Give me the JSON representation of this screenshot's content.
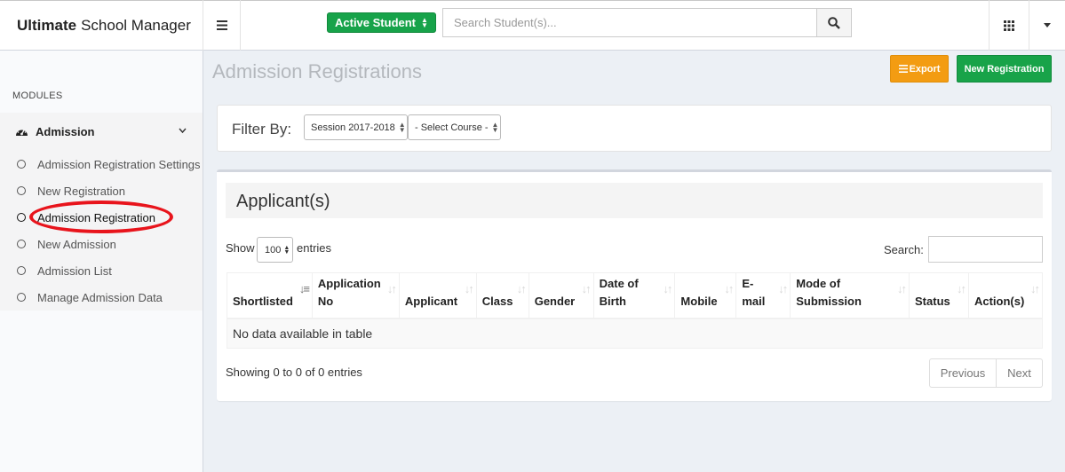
{
  "brand": {
    "bold": "Ultimate",
    "rest": "School Manager"
  },
  "header": {
    "status_select": "Active Student",
    "search_placeholder": "Search Student(s)..."
  },
  "sidebar": {
    "modules_label": "MODULES",
    "tree": {
      "label": "Admission",
      "items": [
        {
          "label": "Admission Registration Settings"
        },
        {
          "label": "New Registration"
        },
        {
          "label": "Admission Registration"
        },
        {
          "label": "New Admission"
        },
        {
          "label": "Admission List"
        },
        {
          "label": "Manage Admission Data"
        }
      ]
    }
  },
  "page": {
    "title": "Admission Registrations",
    "export_label": "Export",
    "new_registration_label": "New Registration"
  },
  "filter": {
    "label": "Filter By:",
    "session": "Session 2017-2018",
    "course": "- Select Course -"
  },
  "applicants": {
    "title": "Applicant(s)",
    "show_label": "Show",
    "page_size": "100",
    "entries_label": "entries",
    "search_label": "Search:",
    "columns": [
      {
        "line1": "",
        "line2": "Shortlisted"
      },
      {
        "line1": "Application",
        "line2": "No"
      },
      {
        "line1": "",
        "line2": "Applicant"
      },
      {
        "line1": "",
        "line2": "Class"
      },
      {
        "line1": "",
        "line2": "Gender"
      },
      {
        "line1": "Date of",
        "line2": "Birth"
      },
      {
        "line1": "",
        "line2": "Mobile"
      },
      {
        "line1": "E-",
        "line2": "mail"
      },
      {
        "line1": "Mode of",
        "line2": "Submission"
      },
      {
        "line1": "",
        "line2": "Status"
      },
      {
        "line1": "",
        "line2": "Action(s)"
      }
    ],
    "empty_message": "No data available in table",
    "info": "Showing 0 to 0 of 0 entries",
    "prev_label": "Previous",
    "next_label": "Next"
  },
  "colors": {
    "success": "#18a349",
    "warning": "#f39c12",
    "highlight": "#e8141c"
  }
}
